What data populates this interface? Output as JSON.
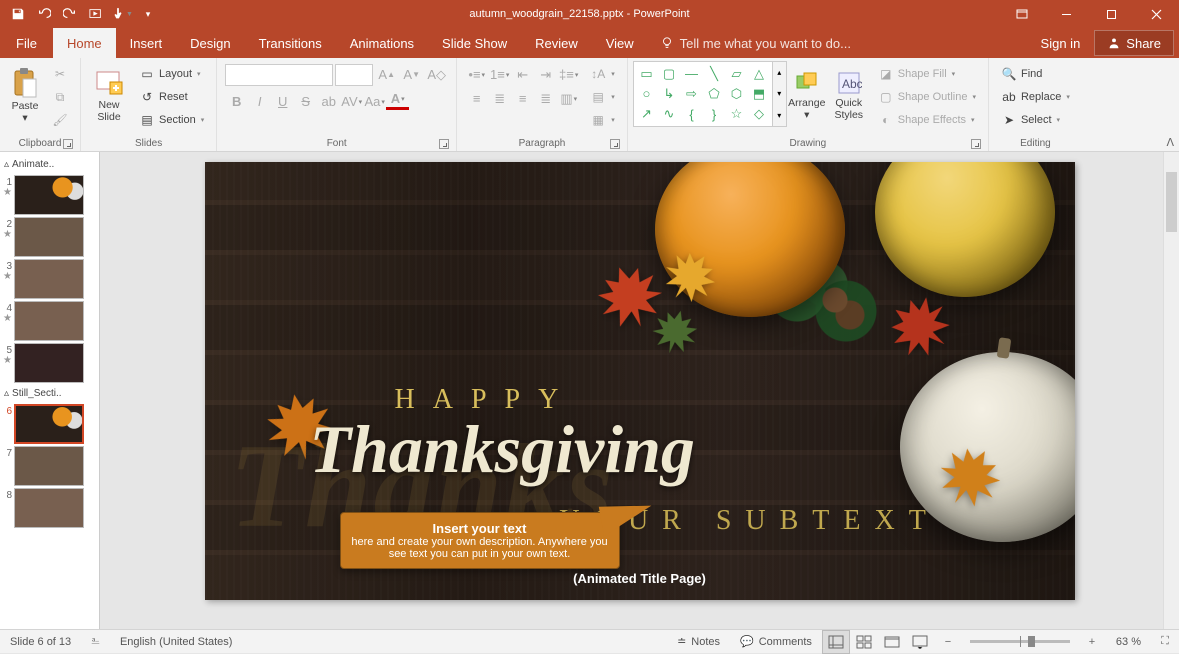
{
  "titlebar": {
    "filename": "autumn_woodgrain_22158.pptx",
    "app": "PowerPoint"
  },
  "menu": {
    "file": "File",
    "tabs": [
      "Home",
      "Insert",
      "Design",
      "Transitions",
      "Animations",
      "Slide Show",
      "Review",
      "View"
    ],
    "active": "Home",
    "tell_me": "Tell me what you want to do...",
    "signin": "Sign in",
    "share": "Share"
  },
  "ribbon": {
    "clipboard": {
      "paste": "Paste",
      "label": "Clipboard"
    },
    "slides": {
      "new_slide": "New\nSlide",
      "layout": "Layout",
      "reset": "Reset",
      "section": "Section",
      "label": "Slides"
    },
    "font": {
      "label": "Font"
    },
    "paragraph": {
      "label": "Paragraph"
    },
    "drawing": {
      "arrange": "Arrange",
      "quick_styles": "Quick\nStyles",
      "shape_fill": "Shape Fill",
      "shape_outline": "Shape Outline",
      "shape_effects": "Shape Effects",
      "label": "Drawing"
    },
    "editing": {
      "find": "Find",
      "replace": "Replace",
      "select": "Select",
      "label": "Editing"
    }
  },
  "thumbnails": {
    "sections": [
      {
        "name": "Animate..",
        "slides": [
          1,
          2,
          3,
          4,
          5
        ]
      },
      {
        "name": "Still_Secti..",
        "slides": [
          6,
          7,
          8
        ]
      }
    ],
    "selected": 6
  },
  "slide": {
    "ghost": "Thanks",
    "happy": "HAPPY",
    "title": "Thanksgiving",
    "subtext": "YOUR SUBTEXT",
    "callout_hd": "Insert your text",
    "callout_body": "here and create your own description. Anywhere you see text you can put in your own text.",
    "anim_note": "(Animated Title Page)"
  },
  "statusbar": {
    "slide_of": "Slide 6 of 13",
    "lang": "English (United States)",
    "notes": "Notes",
    "comments": "Comments",
    "zoom_pct": "63 %"
  }
}
